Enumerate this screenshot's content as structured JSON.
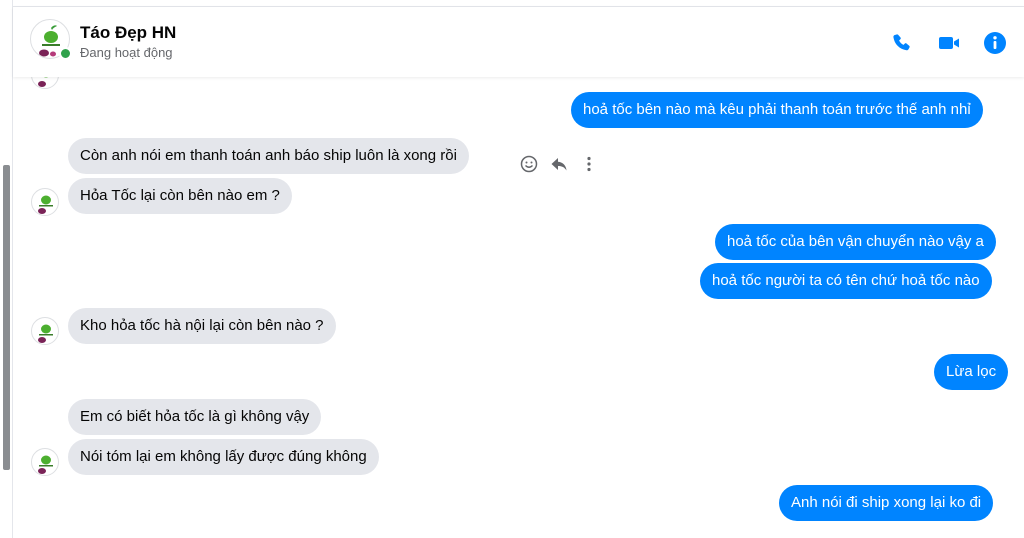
{
  "contact": {
    "name": "Táo Đẹp HN",
    "status": "Đang hoạt động"
  },
  "header_icons": [
    "phone-icon",
    "video-camera-icon",
    "info-icon"
  ],
  "colors": {
    "accent": "#0084ff",
    "incoming_bubble": "#e4e6eb",
    "online": "#31a24c"
  },
  "messages": [
    {
      "dir": "out",
      "text": "hoả tốc bên nào mà kêu phải thanh toán trước thế anh nhỉ"
    },
    {
      "dir": "in",
      "text": "Còn anh nói em thanh toán anh báo ship luôn là xong rồi"
    },
    {
      "dir": "in",
      "text": "Hỏa Tốc lại còn bên nào em ?"
    },
    {
      "dir": "out",
      "text": "hoả tốc của bên vận chuyển nào vậy a"
    },
    {
      "dir": "out",
      "text": "hoả tốc người ta có tên chứ hoả tốc nào"
    },
    {
      "dir": "in",
      "text": "Kho hỏa tốc hà nội lại còn bên nào ?"
    },
    {
      "dir": "out",
      "text": "Lừa lọc"
    },
    {
      "dir": "in",
      "text": "Em có biết hỏa tốc là gì không vậy"
    },
    {
      "dir": "in",
      "text": "Nói tóm lại em không lấy được đúng không"
    },
    {
      "dir": "out",
      "text": "Anh nói đi ship xong lại ko đi"
    }
  ],
  "message_actions": [
    "react-smiley-icon",
    "reply-icon",
    "more-options-icon"
  ]
}
